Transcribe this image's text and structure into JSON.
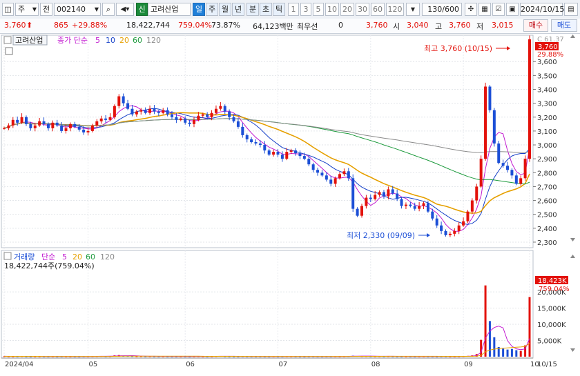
{
  "toolbar": {
    "market_tab": "주",
    "prev_label": "전",
    "stock_code": "002140",
    "credit_badge": "신",
    "stock_name": "고려산업",
    "period_day": "일",
    "period_week": "주",
    "period_month": "월",
    "period_year": "년",
    "period_min": "분",
    "period_sec": "초",
    "period_tick": "틱",
    "intervals": [
      "1",
      "3",
      "5",
      "10",
      "20",
      "30",
      "60",
      "120"
    ],
    "count": "130/600",
    "date": "2024/10/15"
  },
  "info_bar": {
    "price": "3,760",
    "change": "865",
    "change_pct": "+29.88%",
    "volume": "18,422,744",
    "volume_pct": "759.04%",
    "turnover": "73.87%",
    "amount": "64,123백만",
    "best_label": "최우선",
    "best_value": "0",
    "current": "3,760",
    "open_label": "시",
    "open": "3,040",
    "high_label": "고",
    "high": "3,760",
    "low_label": "저",
    "low": "3,015",
    "buy_label": "매수",
    "sell_label": "매도"
  },
  "price_panel": {
    "name_label": "고려산업",
    "legend_label": "종가 단순",
    "ma_periods": [
      "5",
      "10",
      "20",
      "60",
      "120"
    ],
    "ma_colors": [
      "#c21ad0",
      "#1540c8",
      "#e6a000",
      "#1c9a3c",
      "#8a8a8a"
    ],
    "high_annotation": "최고 3,760 (10/15)",
    "low_annotation": "최저 2,330 (09/09)",
    "current_tag": "3,760",
    "c_label": "C 61.37",
    "pct_label": "29.88%"
  },
  "volume_panel": {
    "title": "거래량",
    "legend_label": "단순",
    "ma_periods": [
      "5",
      "20",
      "60",
      "120"
    ],
    "current_text": "18,422,744주(759.04%)",
    "tag": "18,423K",
    "tag_pct": "759.04%"
  },
  "chart_data": [
    {
      "type": "candlestick",
      "title": "고려산업",
      "y_ticks": [
        "2,300",
        "2,400",
        "2,500",
        "2,600",
        "2,700",
        "2,800",
        "2,900",
        "3,000",
        "3,100",
        "3,200",
        "3,300",
        "3,400",
        "3,500",
        "3,600"
      ],
      "ylim": [
        2260,
        3790
      ],
      "x_ticks": [
        "2024/04",
        "05",
        "06",
        "07",
        "08",
        "09",
        "10"
      ],
      "x_end_label": "10/15",
      "high": {
        "value": 3760,
        "date": "10/15"
      },
      "low": {
        "value": 2330,
        "date": "09/09"
      },
      "close": [
        3120,
        3140,
        3180,
        3160,
        3200,
        3150,
        3120,
        3140,
        3170,
        3150,
        3120,
        3160,
        3140,
        3100,
        3120,
        3150,
        3130,
        3110,
        3090,
        3100,
        3140,
        3170,
        3190,
        3180,
        3200,
        3280,
        3350,
        3300,
        3260,
        3220,
        3240,
        3250,
        3230,
        3260,
        3240,
        3230,
        3250,
        3220,
        3200,
        3180,
        3190,
        3160,
        3150,
        3180,
        3210,
        3220,
        3200,
        3230,
        3260,
        3280,
        3240,
        3200,
        3170,
        3130,
        3070,
        3040,
        3020,
        3010,
        3000,
        2960,
        2930,
        2950,
        2930,
        2900,
        2950,
        2960,
        2940,
        2920,
        2900,
        2860,
        2820,
        2800,
        2780,
        2750,
        2720,
        2760,
        2790,
        2810,
        2760,
        2540,
        2490,
        2560,
        2620,
        2610,
        2640,
        2660,
        2630,
        2680,
        2650,
        2610,
        2560,
        2570,
        2560,
        2540,
        2560,
        2580,
        2520,
        2470,
        2420,
        2380,
        2350,
        2360,
        2380,
        2420,
        2450,
        2520,
        2600,
        2700,
        2900,
        3420,
        3250,
        3010,
        2870,
        2850,
        2820,
        2780,
        2720,
        2760,
        2900,
        3760
      ],
      "volume_k": [
        120,
        90,
        80,
        100,
        150,
        80,
        60,
        90,
        100,
        80,
        70,
        90,
        60,
        80,
        90,
        70,
        60,
        50,
        80,
        90,
        120,
        150,
        180,
        110,
        140,
        400,
        500,
        300,
        200,
        150,
        120,
        140,
        110,
        130,
        100,
        90,
        110,
        90,
        80,
        70,
        90,
        70,
        60,
        90,
        110,
        80,
        70,
        90,
        150,
        200,
        120,
        90,
        80,
        70,
        110,
        90,
        80,
        70,
        80,
        70,
        60,
        90,
        60,
        70,
        120,
        100,
        80,
        70,
        60,
        80,
        90,
        70,
        60,
        80,
        70,
        90,
        80,
        120,
        150,
        300,
        200,
        150,
        160,
        110,
        120,
        130,
        100,
        140,
        110,
        90,
        80,
        100,
        90,
        80,
        100,
        110,
        90,
        80,
        70,
        90,
        100,
        80,
        90,
        110,
        150,
        250,
        400,
        800,
        5200,
        22000,
        11000,
        6000,
        3000,
        2500,
        2200,
        2400,
        2000,
        1800,
        3500,
        18423
      ],
      "volume_ticks": [
        "5,000K",
        "10,000K",
        "15,000K",
        "20,000K"
      ]
    }
  ]
}
